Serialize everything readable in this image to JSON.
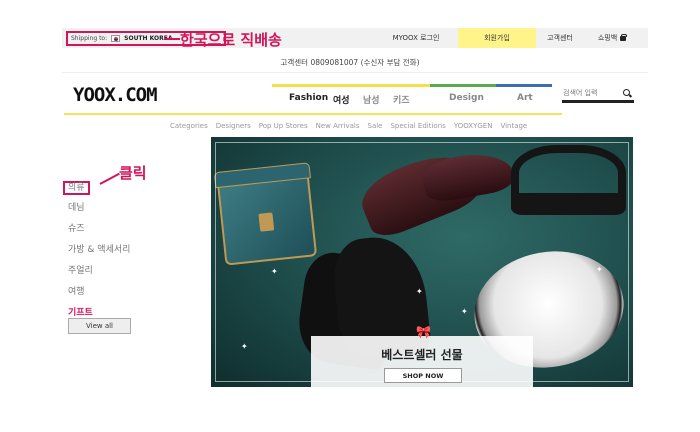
{
  "topbar": {
    "shipping_label": "Shipping to:",
    "shipping_country": "SOUTH KOREA",
    "login": "MYOOX 로그인",
    "join": "회원가입",
    "customer_center": "고객센터",
    "cart": "쇼핑백"
  },
  "annotations": {
    "direct_shipping": "한국으로 직배송",
    "click": "클릭"
  },
  "phone_line": "고객센터 0809081007 (수신자 부담 전화)",
  "logo": "YOOX.COM",
  "main_nav": {
    "fashion": "Fashion",
    "women": "여성",
    "men": "남성",
    "kids": "키즈",
    "design": "Design",
    "art": "Art"
  },
  "search": {
    "placeholder": "검색어 입력"
  },
  "sub_nav": [
    "Categories",
    "Designers",
    "Pop Up Stores",
    "New Arrivals",
    "Sale",
    "Special Editions",
    "YOOXYGEN",
    "Vintage"
  ],
  "sidebar": {
    "items": [
      "의류",
      "데님",
      "슈즈",
      "가방 & 액세서리",
      "주얼리",
      "여행",
      "기프트"
    ],
    "view_all": "View all"
  },
  "hero": {
    "title": "베스트셀러 선물",
    "cta": "SHOP NOW"
  },
  "colors": {
    "annotation": "#d2145a",
    "join_bg": "#fff48a",
    "nav_yellow": "#f4e04b",
    "nav_green": "#5aaa4e",
    "nav_blue": "#3a6fb4"
  }
}
